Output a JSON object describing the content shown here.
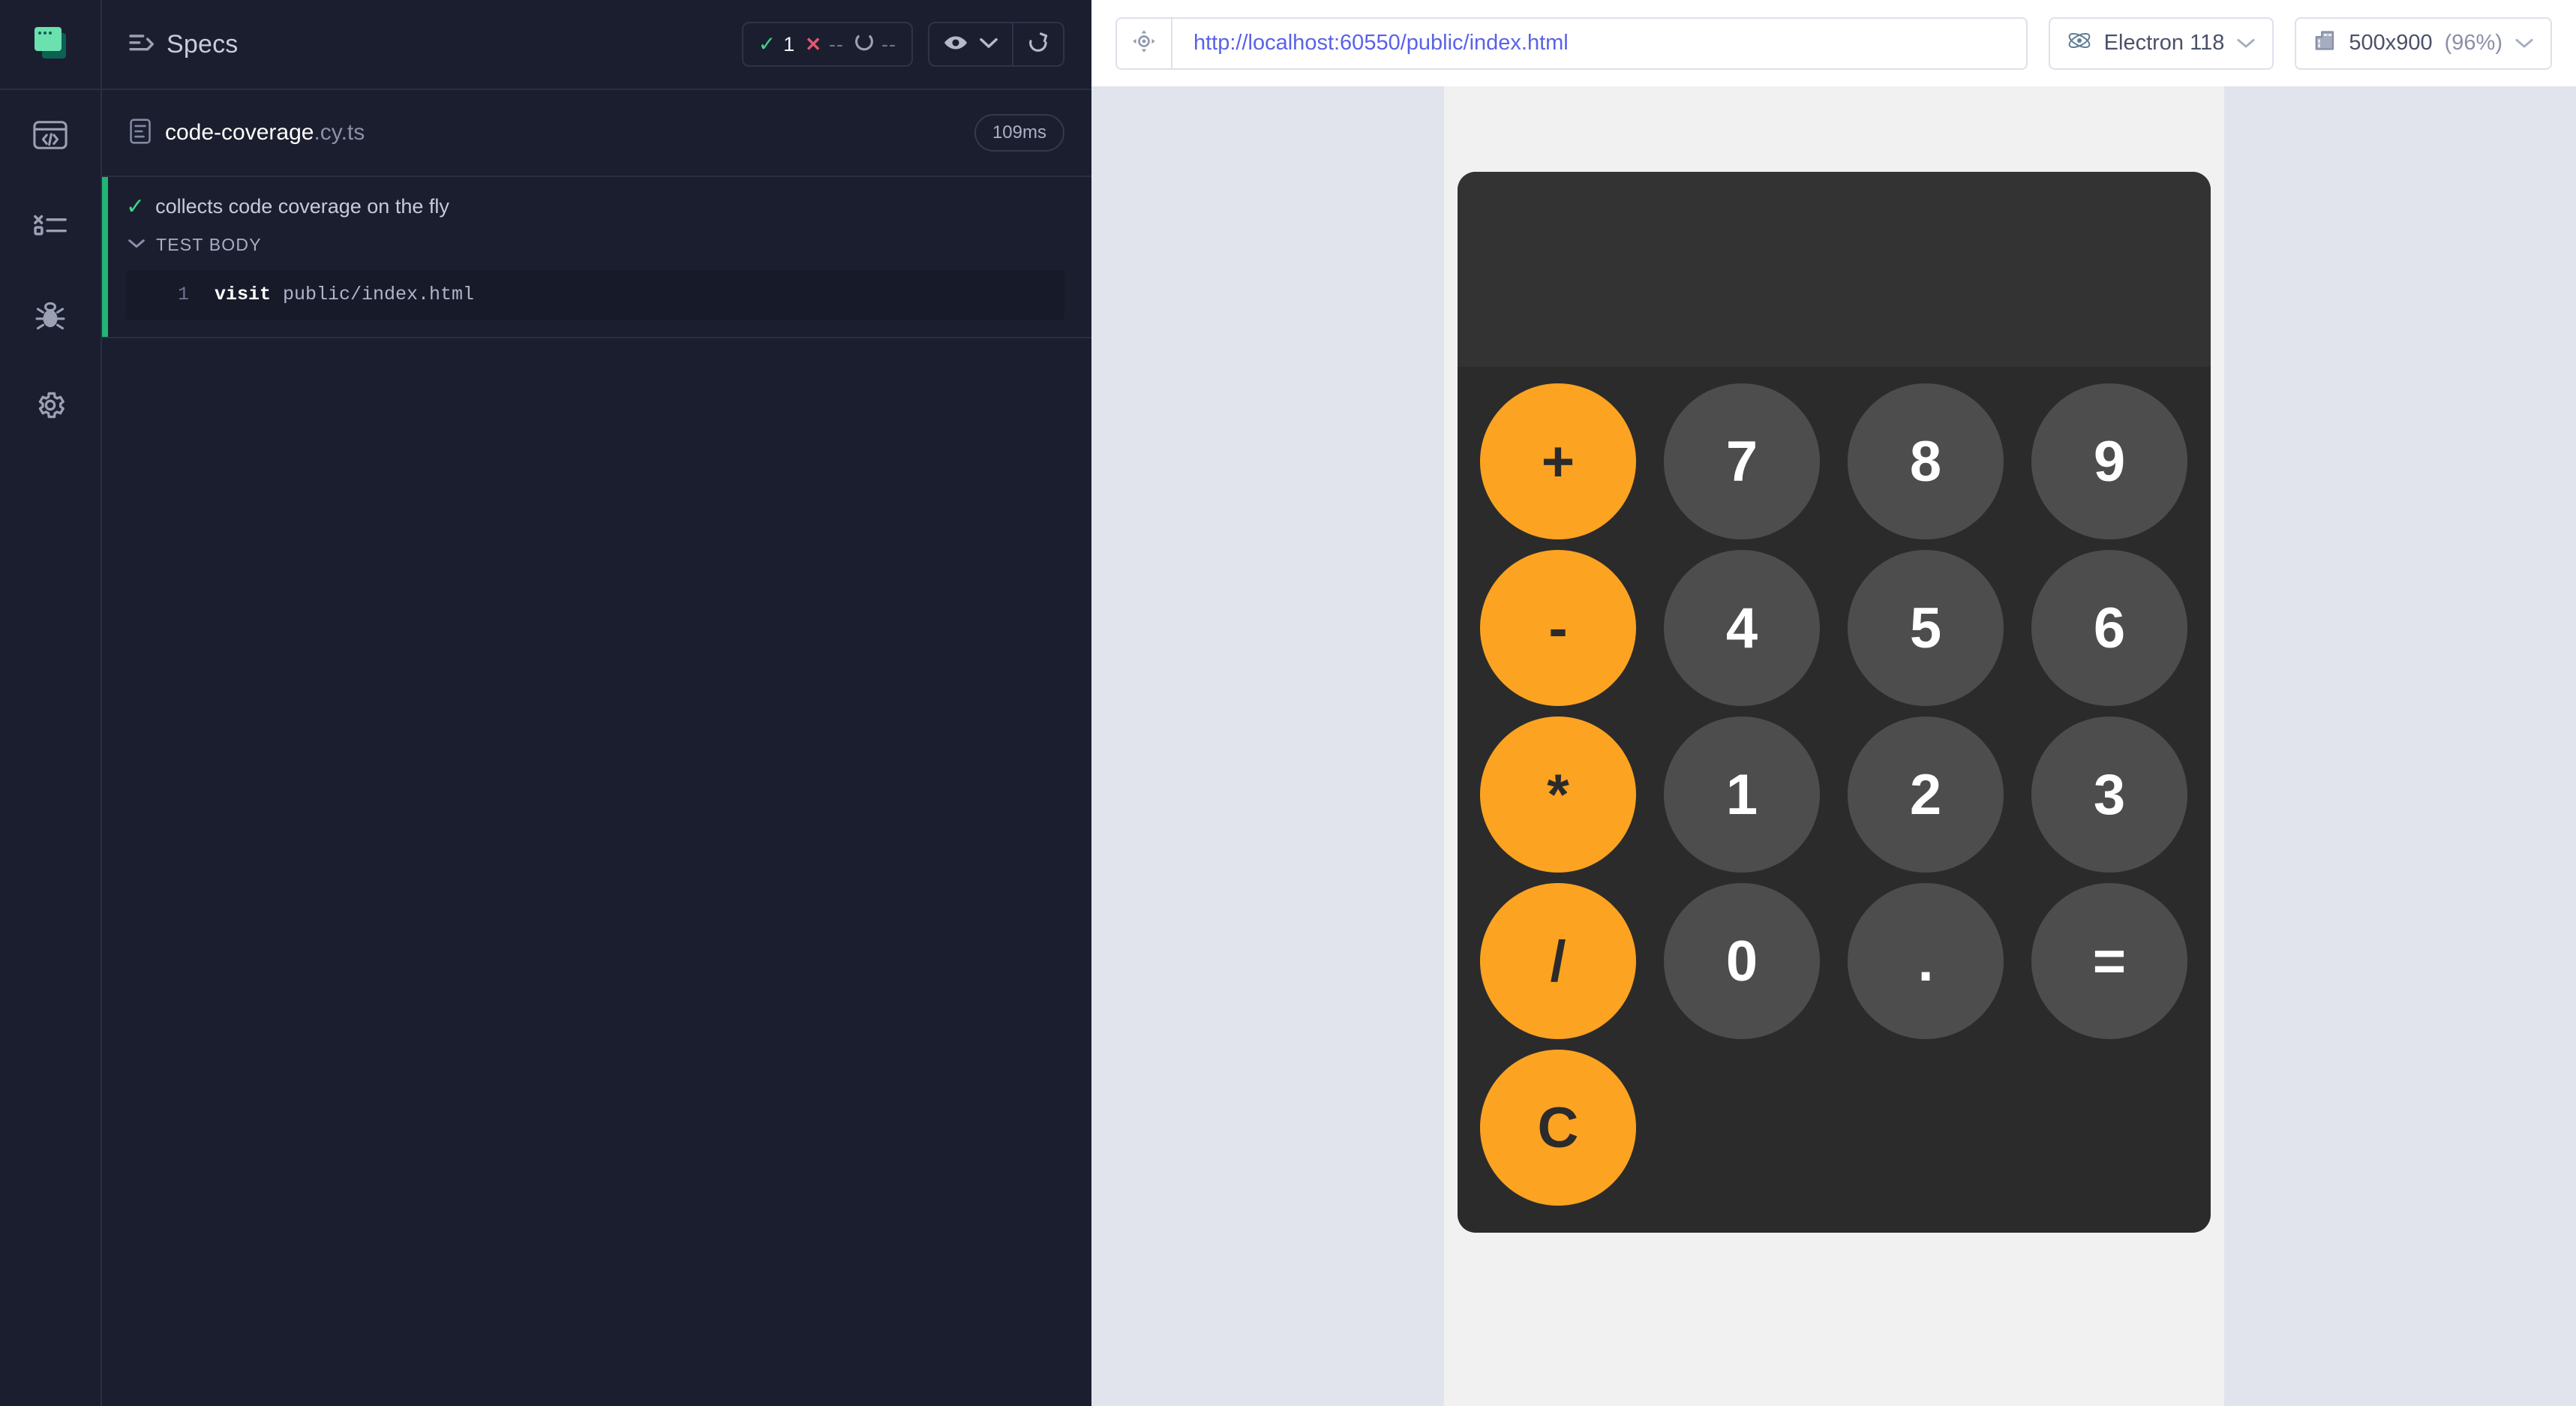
{
  "runner": {
    "rail": {
      "logo_name": "cypress-logo",
      "items": [
        {
          "name": "sidebar-item-specs",
          "icon": "code-window-icon"
        },
        {
          "name": "sidebar-item-runs",
          "icon": "list-checks-icon"
        },
        {
          "name": "sidebar-item-debug",
          "icon": "bug-icon"
        },
        {
          "name": "sidebar-item-settings",
          "icon": "gear-icon"
        }
      ]
    },
    "header": {
      "specs_label": "Specs",
      "specs_icon": "specs-arrow-icon",
      "stats": [
        {
          "name": "passed",
          "icon": "check-icon",
          "value": "1",
          "dim": false
        },
        {
          "name": "failed",
          "icon": "cross-icon",
          "value": "--",
          "dim": true
        },
        {
          "name": "pending",
          "icon": "circle-dash-icon",
          "value": "--",
          "dim": true
        }
      ],
      "controls": [
        {
          "name": "preview-toggle",
          "icon": "eye-icon"
        },
        {
          "name": "preview-dropdown",
          "icon": "chevron-down-icon"
        },
        {
          "name": "rerun-button",
          "icon": "reload-icon"
        }
      ]
    },
    "spec": {
      "file_icon": "file-document-icon",
      "name": "code-coverage",
      "extension": ".cy.ts",
      "duration": "109ms"
    },
    "test": {
      "status_icon": "check-icon",
      "title": "collects code coverage on the fly",
      "body_toggle_icon": "chevron-down-icon",
      "body_label": "TEST BODY",
      "commands": [
        {
          "line": "1",
          "name": "visit",
          "arg": "public/index.html"
        }
      ]
    }
  },
  "aut": {
    "toolbar": {
      "selector_icon": "selector-playground-icon",
      "url": "http://localhost:60550/public/index.html",
      "url_placeholder": "http://localhost:60550/public/index.html",
      "browser": {
        "icon": "electron-icon",
        "label": "Electron 118",
        "caret": "chevron-down-icon"
      },
      "viewport": {
        "icon": "ruler-icon",
        "size": "500x900",
        "scale": "(96%)",
        "caret": "chevron-down-icon"
      }
    },
    "calculator": {
      "display": "",
      "keys": [
        {
          "label": "+",
          "name": "key-plus",
          "type": "op"
        },
        {
          "label": "7",
          "name": "key-7",
          "type": "digit"
        },
        {
          "label": "8",
          "name": "key-8",
          "type": "digit"
        },
        {
          "label": "9",
          "name": "key-9",
          "type": "digit"
        },
        {
          "label": "-",
          "name": "key-minus",
          "type": "op"
        },
        {
          "label": "4",
          "name": "key-4",
          "type": "digit"
        },
        {
          "label": "5",
          "name": "key-5",
          "type": "digit"
        },
        {
          "label": "6",
          "name": "key-6",
          "type": "digit"
        },
        {
          "label": "*",
          "name": "key-multiply",
          "type": "op"
        },
        {
          "label": "1",
          "name": "key-1",
          "type": "digit"
        },
        {
          "label": "2",
          "name": "key-2",
          "type": "digit"
        },
        {
          "label": "3",
          "name": "key-3",
          "type": "digit"
        },
        {
          "label": "/",
          "name": "key-divide",
          "type": "op"
        },
        {
          "label": "0",
          "name": "key-0",
          "type": "digit"
        },
        {
          "label": ".",
          "name": "key-decimal",
          "type": "digit"
        },
        {
          "label": "=",
          "name": "key-equals",
          "type": "digit"
        },
        {
          "label": "C",
          "name": "key-clear",
          "type": "op"
        }
      ]
    }
  },
  "colors": {
    "runner_bg": "#1B1E2E",
    "pass_green": "#3FD38A",
    "fail_red": "#E45770",
    "url_blue": "#5A62E8",
    "calc_orange": "#FCA321",
    "calc_key_gray": "#4D4D4D",
    "calc_body": "#2B2B2B",
    "calc_display": "#333333"
  }
}
